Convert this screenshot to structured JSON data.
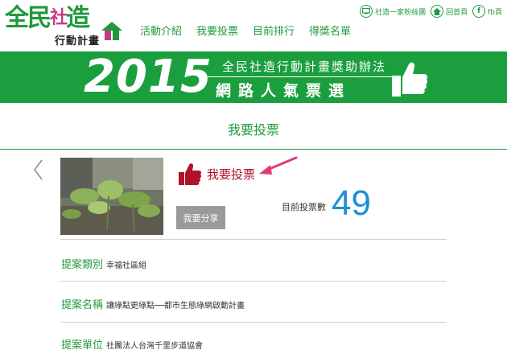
{
  "logo": {
    "text_main_1": "全民",
    "text_main_2": "社",
    "text_main_3": "造",
    "text_sub": "行動計畫"
  },
  "nav": {
    "items": [
      {
        "label": "活動介紹"
      },
      {
        "label": "我要投票"
      },
      {
        "label": "目前排行"
      },
      {
        "label": "得獎名單"
      }
    ]
  },
  "toplinks": {
    "fans": "社造一家粉絲團",
    "home": "回首頁",
    "fb": "fb頁"
  },
  "banner": {
    "year": "2015",
    "line1": "全民社造行動計畫獎助辦法",
    "line2": "網路人氣票選"
  },
  "page": {
    "title": "我要投票"
  },
  "vote": {
    "label": "我要投票",
    "share_label": "我要分享",
    "count_label": "目前投票數",
    "count": "49"
  },
  "details": {
    "category_key": "提案類別",
    "category_value": "幸福社區組",
    "name_key": "提案名稱",
    "name_value": "讓綠點更綠點──都市生態綠網啟動計畫",
    "org_key": "提案單位",
    "org_value": "社團法人台灣千里步道協會"
  },
  "colors": {
    "brand_green": "#1b9f3e",
    "vote_red": "#b0122a",
    "count_blue": "#1c8fd6",
    "arrow_pink": "#e23a7a"
  }
}
